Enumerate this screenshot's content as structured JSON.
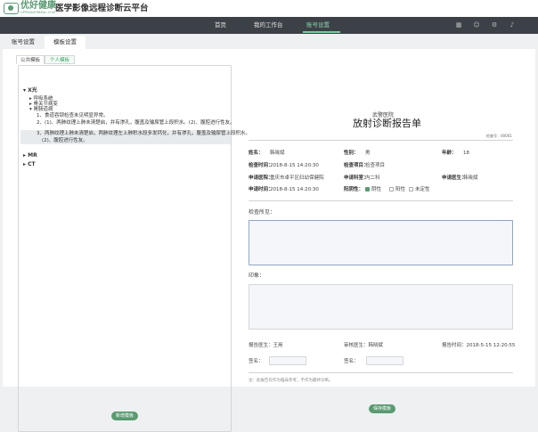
{
  "brand": {
    "name": "优好健康",
    "sub": "UPPSANORBEAL.COM",
    "title": "医学影像远程诊断云平台"
  },
  "nav": {
    "home": "首页",
    "workbench": "我的工作台",
    "account": "账号设置"
  },
  "nav_icons": [
    "grid-icon",
    "user-icon",
    "settings-icon",
    "bell-icon"
  ],
  "page_tabs": {
    "account": "账号设置",
    "template": "模板设置"
  },
  "sub_tabs": {
    "public": "公共模板",
    "personal": "个人模板"
  },
  "tree": {
    "xray": "X光",
    "xray_children": [
      "呼吸系统",
      "骨关节病变",
      "胃肠道病"
    ],
    "lines": [
      "1、食道吞钡检查未见明显异常。",
      "2、(1)、两肺纹理上肺未清楚启，并有渗孔，腹盖及输尿管上段积水。(2)、腹腔进行性友。",
      "3、两肺纹理上肺未清楚启，两肺纹理左上肺积水段多发钙化，并有渗孔，腹盖及输尿管上段积水。",
      "(2)、腹腔进行性友。"
    ],
    "mr": "MR",
    "ct": "CT",
    "add_button": "新增模板"
  },
  "report": {
    "hospital": "武警医院",
    "title": "放射诊断报告单",
    "number": "检查号：00001",
    "name_label": "姓名：",
    "name": "韩晓斌",
    "sex_label": "性别：",
    "sex": "男",
    "age_label": "年龄：",
    "age": "18",
    "exam_time_label": "检查时间：",
    "exam_time": "2018-8-15 14:20:30",
    "exam_item_label": "检查项目：",
    "exam_item": "检查项目",
    "req_hospital_label": "申请医院：",
    "req_hospital": "重庆市卓平区妇幼保健院",
    "req_dept_label": "申请科室：",
    "req_dept": "内二科",
    "req_doctor_label": "申请医生：",
    "req_doctor": "韩晓斌",
    "req_time_label": "申请时间：",
    "req_time": "2018-8-15 14:20:30",
    "result_label": "阳阴性：",
    "results": [
      "阴性",
      "阳性",
      "未定性"
    ],
    "findings_label": "检查所见：",
    "impression_label": "印象：",
    "report_doctor": "报告医生：王用",
    "review_doctor": "审核医生：韩晓斌",
    "report_time": "报告时间：2018-5-15 12:20:55",
    "sign_label": "签名：",
    "sign_label2": "签名：",
    "note": "注：此报告仅作为临床参考，不作为最终诊断。",
    "save_button": "保存模板"
  }
}
